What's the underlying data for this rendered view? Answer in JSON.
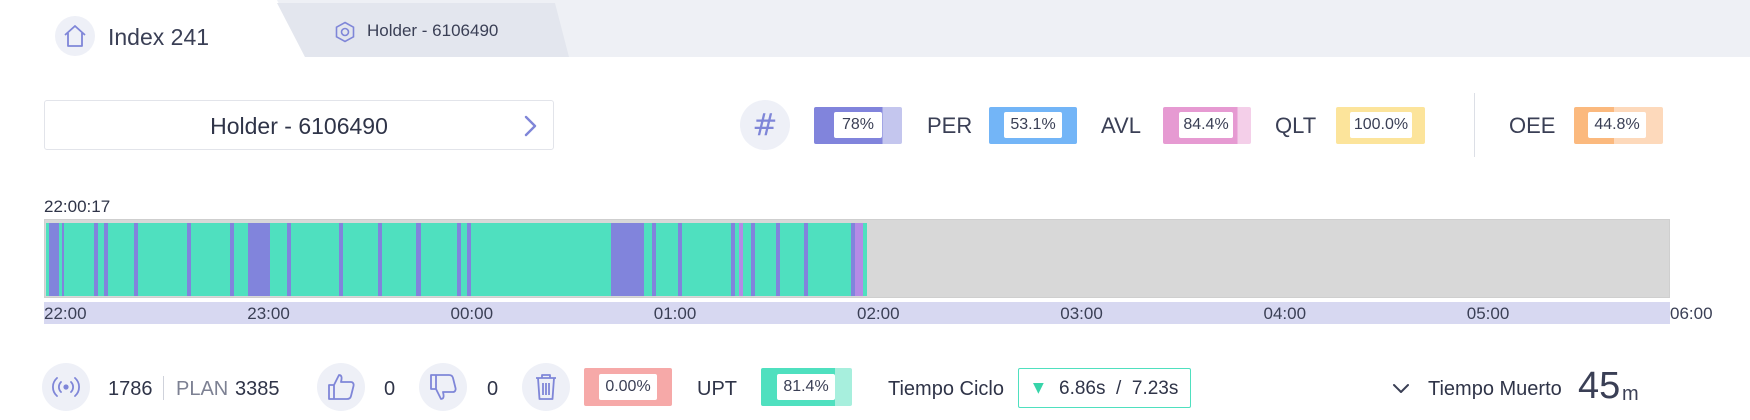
{
  "tabs": [
    {
      "label": "Index 241",
      "icon": "home-icon"
    },
    {
      "label": "Holder - 6106490",
      "icon": "hexagon-icon"
    }
  ],
  "selector": {
    "label": "Holder - 6106490"
  },
  "kpis": {
    "first": {
      "value": "78%",
      "level": 0.78,
      "color": "#8184dc",
      "bg": "#c4c6ee"
    },
    "per": {
      "label": "PER",
      "value": "53.1%",
      "level": 1.0,
      "color": "#73b5f7",
      "bg": "#73b5f7"
    },
    "avl": {
      "label": "AVL",
      "value": "84.4%",
      "level": 0.844,
      "color": "#e69ad2",
      "bg": "#f4cfe9"
    },
    "qlt": {
      "label": "QLT",
      "value": "100.0%",
      "level": 1.0,
      "color": "#fce49b",
      "bg": "#fce49b"
    },
    "oee": {
      "label": "OEE",
      "value": "44.8%",
      "level": 0.448,
      "color": "#fbb97e",
      "bg": "#fdd9bb"
    }
  },
  "timeline": {
    "start_label": "22:00:17",
    "ticks": [
      "22:00",
      "23:00",
      "00:00",
      "01:00",
      "02:00",
      "03:00",
      "04:00",
      "05:00",
      "06:00"
    ],
    "colors": {
      "running": "#4fe0bf",
      "stop": "#8184dc",
      "other": "#b48be6",
      "empty": "#d8d8d8"
    },
    "run_start_h": 0.005,
    "run_end_h": 4.05,
    "stops_h": [
      [
        0.02,
        0.07
      ],
      [
        0.085,
        0.095
      ],
      [
        0.24,
        0.26
      ],
      [
        0.29,
        0.31
      ],
      [
        0.44,
        0.46
      ],
      [
        0.7,
        0.72
      ],
      [
        0.91,
        0.93
      ],
      [
        1.0,
        1.11
      ],
      [
        1.19,
        1.21
      ],
      [
        1.45,
        1.47
      ],
      [
        1.64,
        1.66
      ],
      [
        1.83,
        1.85
      ],
      [
        2.03,
        2.05
      ],
      [
        2.08,
        2.1
      ],
      [
        2.79,
        2.95
      ],
      [
        2.99,
        3.01
      ],
      [
        3.12,
        3.14
      ],
      [
        3.38,
        3.4
      ],
      [
        3.48,
        3.5
      ],
      [
        3.6,
        3.62
      ],
      [
        3.74,
        3.76
      ],
      [
        3.97,
        3.99
      ]
    ],
    "other_h": [
      [
        3.42,
        3.44
      ],
      [
        3.99,
        4.03
      ]
    ]
  },
  "bottom": {
    "count": "1786",
    "plan_label": "PLAN",
    "plan_value": "3385",
    "likes": "0",
    "dislikes": "0",
    "scrap": {
      "value": "0.00%",
      "color": "#f6a9a8"
    },
    "upt": {
      "label": "UPT",
      "value": "81.4%",
      "level": 0.814,
      "color": "#4fe0bf",
      "bg": "#a7efdd"
    },
    "ciclo": {
      "label": "Tiempo Ciclo",
      "values": "6.86s  /  7.23s"
    },
    "muerto": {
      "label": "Tiempo Muerto",
      "value": "45",
      "unit": "m"
    }
  },
  "icons": [
    "home-icon",
    "hexagon-icon",
    "chevron-right-icon",
    "hash-icon",
    "signal-icon",
    "thumbs-up-icon",
    "thumbs-down-icon",
    "trash-icon",
    "chevron-down-icon",
    "triangle-down-icon"
  ]
}
